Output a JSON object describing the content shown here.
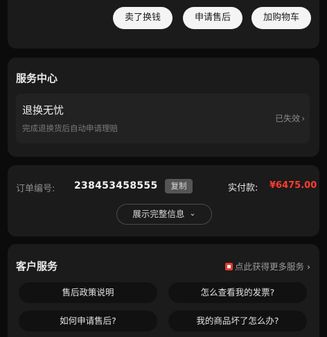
{
  "top_actions": {
    "sell_label": "卖了换钱",
    "aftersale_label": "申请售后",
    "add_cart_label": "加购物车"
  },
  "service_center": {
    "title": "服务中心",
    "item_title": "退换无忧",
    "item_desc": "完成退换货后自动申请理赔",
    "item_status": "已失效",
    "chevron": "›"
  },
  "order": {
    "number_label": "订单编号:",
    "number": "238453458555",
    "copy_label": "复制",
    "paid_label": "实付款:",
    "paid_amount": "¥6475.00",
    "expand_label": "展示完整信息",
    "expand_icon": "⌄"
  },
  "customer_service": {
    "title": "客户服务",
    "more_link": "点此获得更多服务",
    "chevron": "›",
    "questions": [
      "售后政策说明",
      "怎么查看我的发票?",
      "如何申请售后?",
      "我的商品坏了怎么办?"
    ]
  },
  "colors": {
    "background": "#0b0b0b",
    "card": "#1b1b1b",
    "price_red": "#ff3b30"
  },
  "icons": {
    "status_chevron": "chevron-right-icon",
    "expand_chevron": "chevron-down-icon",
    "service_flag": "red-flag-icon"
  }
}
